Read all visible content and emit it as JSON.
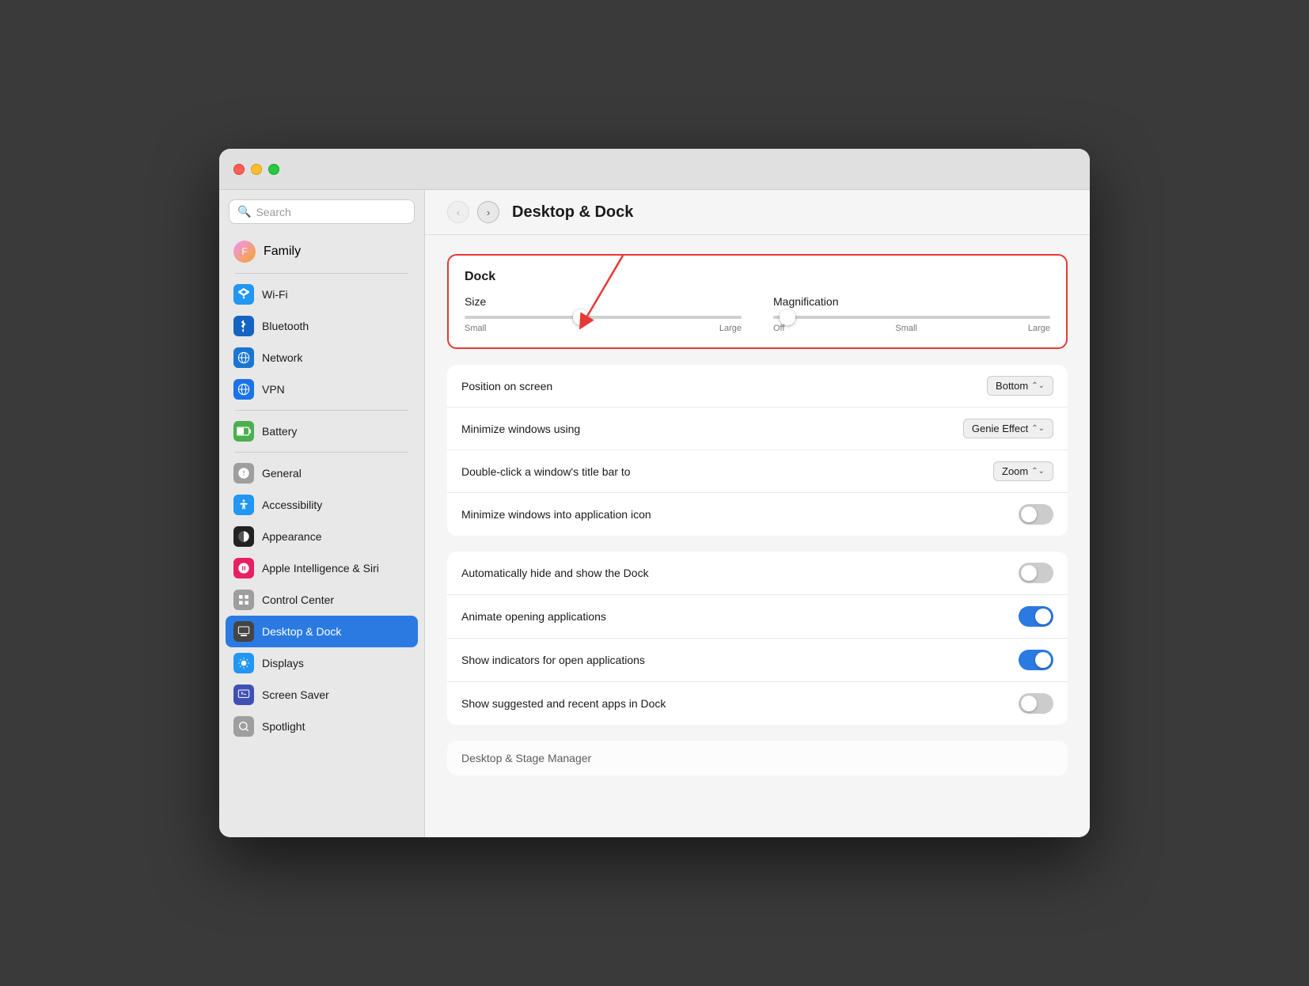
{
  "window": {
    "title": "Desktop & Dock"
  },
  "sidebar": {
    "search_placeholder": "Search",
    "user": {
      "name": "Family",
      "initials": "F"
    },
    "items": [
      {
        "id": "wifi",
        "label": "Wi-Fi",
        "icon_type": "wifi",
        "icon_char": "📶"
      },
      {
        "id": "bluetooth",
        "label": "Bluetooth",
        "icon_type": "bluetooth",
        "icon_char": "B"
      },
      {
        "id": "network",
        "label": "Network",
        "icon_type": "network",
        "icon_char": "🌐"
      },
      {
        "id": "vpn",
        "label": "VPN",
        "icon_type": "vpn",
        "icon_char": "🌐"
      },
      {
        "id": "battery",
        "label": "Battery",
        "icon_type": "battery",
        "icon_char": "🔋"
      },
      {
        "id": "general",
        "label": "General",
        "icon_type": "general",
        "icon_char": "⚙"
      },
      {
        "id": "accessibility",
        "label": "Accessibility",
        "icon_type": "accessibility",
        "icon_char": "♿"
      },
      {
        "id": "appearance",
        "label": "Appearance",
        "icon_type": "appearance",
        "icon_char": "●"
      },
      {
        "id": "siri",
        "label": "Apple Intelligence & Siri",
        "icon_type": "siri",
        "icon_char": "✦"
      },
      {
        "id": "controlcenter",
        "label": "Control Center",
        "icon_type": "controlcenter",
        "icon_char": "⊞"
      },
      {
        "id": "desktopdock",
        "label": "Desktop & Dock",
        "icon_type": "desktopdock",
        "icon_char": "▬",
        "active": true
      },
      {
        "id": "displays",
        "label": "Displays",
        "icon_type": "displays",
        "icon_char": "☀"
      },
      {
        "id": "screensaver",
        "label": "Screen Saver",
        "icon_type": "screensaver",
        "icon_char": "🖼"
      },
      {
        "id": "spotlight",
        "label": "Spotlight",
        "icon_type": "spotlight",
        "icon_char": "🔍"
      }
    ]
  },
  "detail": {
    "title": "Desktop & Dock",
    "dock_section": {
      "title": "Dock",
      "size_label": "Size",
      "size_small": "Small",
      "size_large": "Large",
      "size_value": 42,
      "magnification_label": "Magnification",
      "magnification_off": "Off",
      "magnification_small": "Small",
      "magnification_large": "Large",
      "magnification_value": 5
    },
    "settings": [
      {
        "id": "position",
        "label": "Position on screen",
        "type": "dropdown",
        "value": "Bottom"
      },
      {
        "id": "minimize",
        "label": "Minimize windows using",
        "type": "dropdown",
        "value": "Genie Effect"
      },
      {
        "id": "doubleclick",
        "label": "Double-click a window's title bar to",
        "type": "dropdown",
        "value": "Zoom"
      },
      {
        "id": "minimizeinto",
        "label": "Minimize windows into application icon",
        "type": "toggle",
        "value": false
      }
    ],
    "dock_toggles": [
      {
        "id": "autohide",
        "label": "Automatically hide and show the Dock",
        "type": "toggle",
        "value": false
      },
      {
        "id": "animate",
        "label": "Animate opening applications",
        "type": "toggle",
        "value": true
      },
      {
        "id": "indicators",
        "label": "Show indicators for open applications",
        "type": "toggle",
        "value": true
      },
      {
        "id": "suggestedapps",
        "label": "Show suggested and recent apps in Dock",
        "type": "toggle",
        "value": false
      }
    ],
    "partial_section_label": "Desktop & Stage Manager"
  },
  "colors": {
    "active_sidebar": "#2a7ae2",
    "toggle_on": "#2a7ae2",
    "toggle_off": "#ccc",
    "red_border": "#e53935"
  }
}
